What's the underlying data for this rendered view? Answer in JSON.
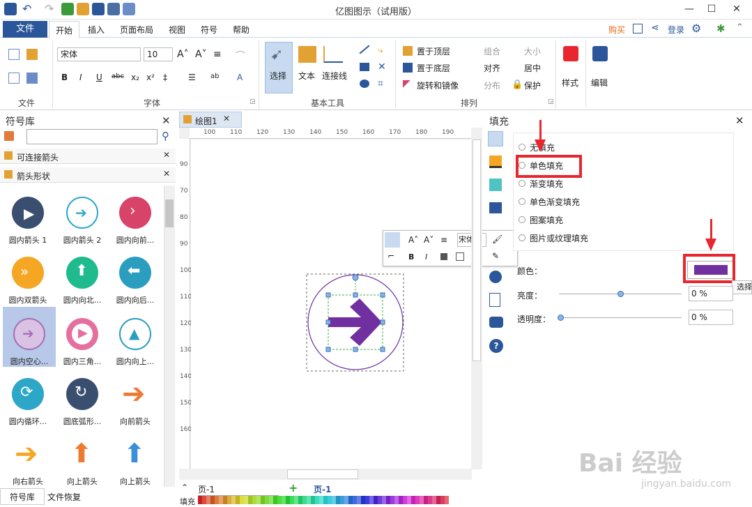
{
  "window": {
    "title": "亿图图示（试用版）",
    "min": "—",
    "max": "☐",
    "close": "✕"
  },
  "ribbon_tabs": {
    "file": "文件",
    "home": "开始",
    "insert": "插入",
    "page_layout": "页面布局",
    "view": "视图",
    "symbol": "符号",
    "help": "帮助"
  },
  "top_right": {
    "buy": "购买",
    "login": "登录"
  },
  "groups": {
    "file": "文件",
    "font": "字体",
    "basic_tools": "基本工具",
    "arrange": "排列"
  },
  "font": {
    "name": "宋体",
    "size": "10"
  },
  "tools": {
    "select": "选择",
    "text": "文本",
    "connector": "连接线"
  },
  "arrange": {
    "bring_front": "置于顶层",
    "send_back": "置于底层",
    "rotate": "旋转和镜像",
    "group": "组合",
    "align": "对齐",
    "distribute": "分布",
    "size": "大小",
    "center": "居中",
    "protect": "保护"
  },
  "style_btn": "样式",
  "edit_btn": "编辑",
  "symbol_lib": {
    "title": "符号库",
    "search_placeholder": "",
    "cat1": "可连接箭头",
    "cat2": "箭头形状",
    "items": [
      "圆内箭头 1",
      "圆内箭头 2",
      "圆内向前...",
      "圆内双箭头",
      "圆内向北...",
      "圆内向后...",
      "圆内空心...",
      "圆内三角...",
      "圆内向上...",
      "圆内循环...",
      "圆底弧形...",
      "向前箭头",
      "向右箭头",
      "向上箭头",
      "向上箭头"
    ]
  },
  "bottom_tabs": {
    "symbols": "符号库",
    "recovery": "文件恢复"
  },
  "doc_tab": "绘图1",
  "ruler_h": [
    "100",
    "110",
    "120",
    "130",
    "140",
    "150",
    "160",
    "170",
    "180",
    "190"
  ],
  "ruler_v": [
    "90",
    "70",
    "80",
    "90",
    "100",
    "110",
    "120",
    "130",
    "140",
    "150",
    "160"
  ],
  "page_nav": {
    "page_sel": "页-1",
    "page_tab": "页-1"
  },
  "fill_label": "填充",
  "float_toolbar": {
    "font": "宋体"
  },
  "fill_panel": {
    "title": "填充",
    "opt_none": "无填充",
    "opt_solid": "单色填充",
    "opt_gradient": "渐变填充",
    "opt_solid_gradient": "单色渐变填充",
    "opt_pattern": "图案填充",
    "opt_picture": "图片或纹理填充",
    "color_label": "颜色：",
    "brightness_label": "亮度：",
    "brightness": "0 %",
    "transparency_label": "透明度：",
    "transparency": "0 %",
    "tooltip": "选择"
  },
  "colors": {
    "accent": "#2b579a",
    "fill_color": "#7030a0",
    "red": "#e8262d"
  },
  "watermark": {
    "brand": "Bai 经验",
    "url": "jingyan.baidu.com"
  }
}
